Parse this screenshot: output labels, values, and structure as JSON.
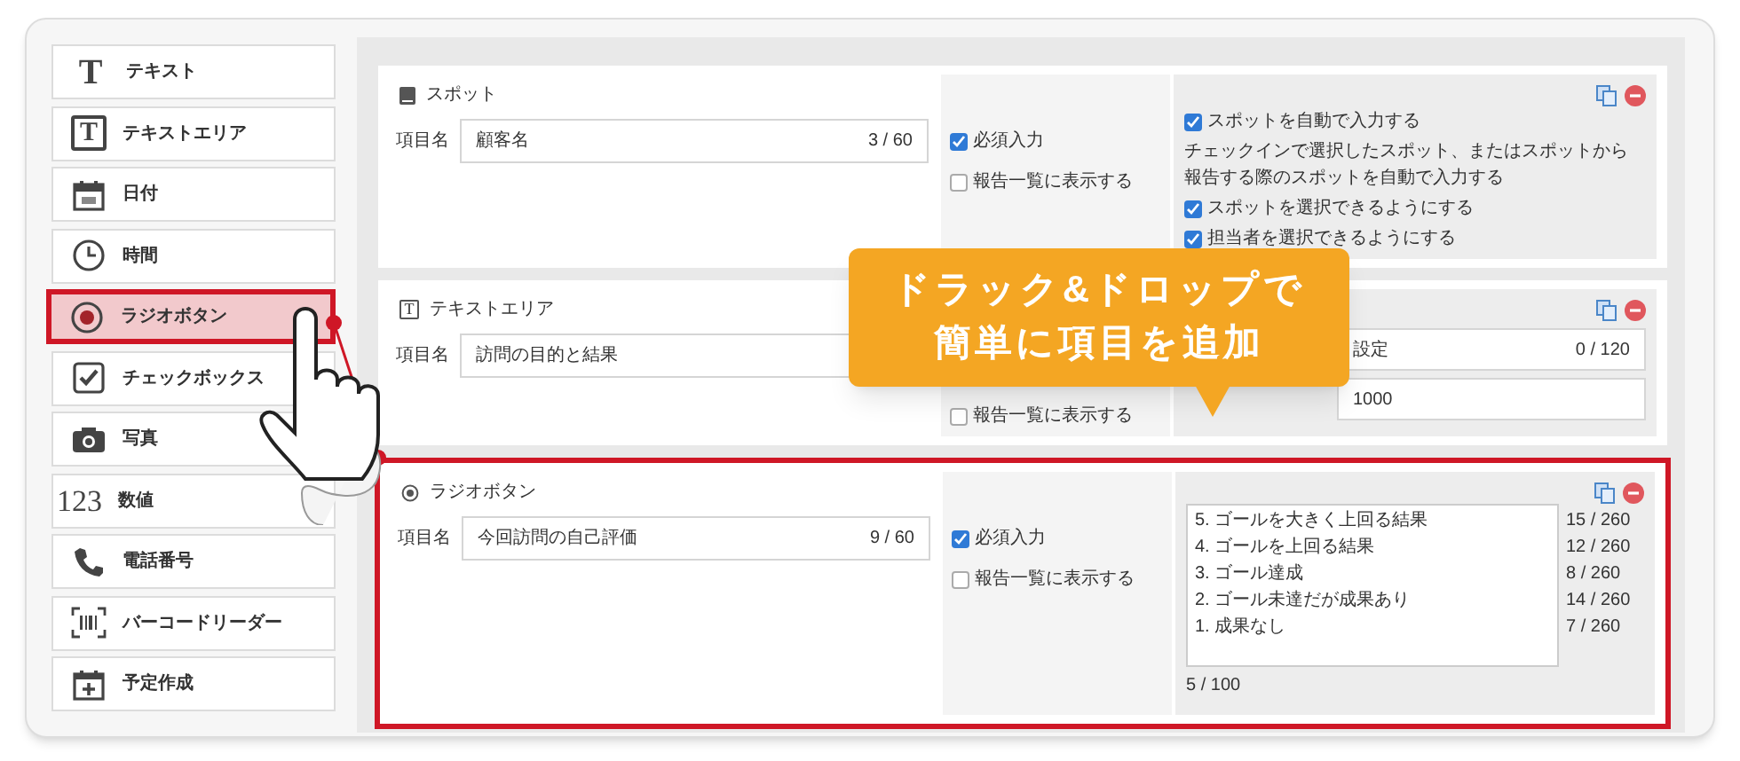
{
  "sidebar": {
    "items": [
      {
        "kind": "text",
        "icon_text": "T",
        "label": "テキスト",
        "selected": false
      },
      {
        "kind": "textarea",
        "icon_text": "T",
        "label": "テキストエリア",
        "selected": false
      },
      {
        "kind": "date",
        "label": "日付",
        "selected": false
      },
      {
        "kind": "time",
        "label": "時間",
        "selected": false
      },
      {
        "kind": "radio",
        "label": "ラジオボタン",
        "selected": true
      },
      {
        "kind": "checkbox",
        "label": "チェックボックス",
        "selected": false
      },
      {
        "kind": "photo",
        "label": "写真",
        "selected": false
      },
      {
        "kind": "number",
        "icon_text": "123",
        "label": "数値",
        "selected": false
      },
      {
        "kind": "phone",
        "label": "電話番号",
        "selected": false
      },
      {
        "kind": "barcode",
        "label": "バーコードリーダー",
        "selected": false
      },
      {
        "kind": "schedule",
        "label": "予定作成",
        "selected": false
      }
    ]
  },
  "cards": [
    {
      "kind": "spot",
      "title": "スポット",
      "highlighted": false,
      "field_label": "項目名",
      "value": "顧客名",
      "counter": "3 / 60",
      "options": [
        {
          "label": "必須入力",
          "checked": true
        },
        {
          "label": "報告一覧に表示する",
          "checked": false
        }
      ],
      "settings": {
        "kind": "checklist",
        "items": [
          {
            "kind": "checkbox",
            "label": "スポットを自動で入力する",
            "checked": true
          },
          {
            "kind": "note",
            "text": "チェックインで選択したスポット、またはスポットから報告する際のスポットを自動で入力する"
          },
          {
            "kind": "checkbox",
            "label": "スポットを選択できるようにする",
            "checked": true
          },
          {
            "kind": "checkbox",
            "label": "担当者を選択できるようにする",
            "checked": true
          }
        ]
      }
    },
    {
      "kind": "textarea",
      "icon_text": "T",
      "title": "テキストエリア",
      "highlighted": false,
      "field_label": "項目名",
      "value": "訪問の目的と結果",
      "options": [
        {
          "label": "報告一覧に表示する",
          "checked": false
        }
      ],
      "settings": {
        "kind": "fields",
        "fields": [
          {
            "value": "設定",
            "counter": "0 / 120"
          },
          {
            "value": "1000"
          }
        ]
      }
    },
    {
      "kind": "radio",
      "title": "ラジオボタン",
      "highlighted": true,
      "field_label": "項目名",
      "value": "今回訪問の自己評価",
      "counter": "9 / 60",
      "options": [
        {
          "label": "必須入力",
          "checked": true
        },
        {
          "label": "報告一覧に表示する",
          "checked": false
        }
      ],
      "settings": {
        "kind": "choices",
        "choices": [
          {
            "text": "5. ゴールを大きく上回る結果",
            "counter": "15 / 260"
          },
          {
            "text": "4. ゴールを上回る結果",
            "counter": "12 / 260"
          },
          {
            "text": "3. ゴール達成",
            "counter": "8 / 260"
          },
          {
            "text": "2. ゴール未達だが成果あり",
            "counter": "14 / 260"
          },
          {
            "text": "1. 成果なし",
            "counter": "7 / 260"
          }
        ],
        "total": "5 / 100"
      }
    }
  ],
  "callout": {
    "lines": [
      "ドラック&ドロップで",
      "簡単に項目を追加"
    ]
  }
}
